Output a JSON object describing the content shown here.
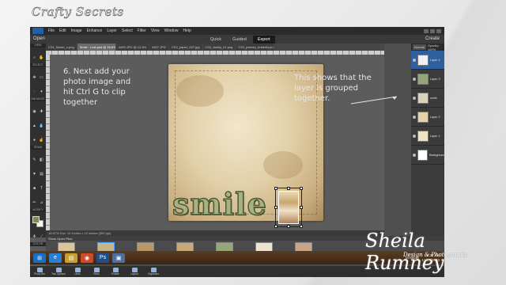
{
  "brand": {
    "logo_text": "Crafty Secrets",
    "watermark_name": "Sheila Rumney",
    "watermark_tagline": "Design & Photography"
  },
  "menubar": {
    "items": [
      "File",
      "Edit",
      "Image",
      "Enhance",
      "Layer",
      "Select",
      "Filter",
      "View",
      "Window",
      "Help"
    ]
  },
  "modebar": {
    "open_label": "Open",
    "tabs": [
      "Quick",
      "Guided",
      "Expert"
    ],
    "active_tab": "Expert",
    "create_label": "Create"
  },
  "doc_tabs": [
    "CS1_flower_c.png",
    "Smile : Lost.psd @ 16.6% (Layer 4, RGB/8)",
    "4405.JPG @ 12.4%",
    "4407.JPG",
    "CS2_paper_007.jpg",
    "CS2_family_01.png",
    "CS2_jewelry_butterfly.png"
  ],
  "toolbox": {
    "sections": [
      "VIEW",
      "SELECT",
      "ENHANCE",
      "DRAW",
      "MODIFY",
      "COLOR"
    ],
    "fg_color": "#7c8a55",
    "bg_color": "#f4f4f4"
  },
  "canvas": {
    "word": "smile"
  },
  "annotations": {
    "left": "6. Next add your photo image and hit Ctrl G to clip together",
    "right": "This shows that the layer is grouped together."
  },
  "status_bar": "16.67%   Doc: 12 inches x 12 inches (300 ppi)",
  "layers_panel": {
    "blend_mode": "Normal",
    "opacity_label": "Opacity: 100%",
    "layers": [
      {
        "name": "Layer 4",
        "selected": true,
        "thumb": "#f0f0f0"
      },
      {
        "name": "Layer 3",
        "selected": false,
        "thumb": "#95a679"
      },
      {
        "name": "smile",
        "selected": false,
        "thumb": "#d9d2bf"
      },
      {
        "name": "Layer 2",
        "selected": false,
        "thumb": "#e4d2aa"
      },
      {
        "name": "Layer 1",
        "selected": false,
        "thumb": "#efe3c4"
      },
      {
        "name": "Background",
        "selected": false,
        "thumb": "#ffffff"
      }
    ]
  },
  "photo_bin": {
    "header": "Show Open Files",
    "items": [
      {
        "label": "CS1_flower_c.png",
        "thumb": "#d9c79a"
      },
      {
        "label": "Smile - Lost.psd",
        "thumb": "#c9b48a",
        "active": true
      },
      {
        "label": "4405.JPG",
        "thumb": "#b8976a"
      },
      {
        "label": "4407.JPG",
        "thumb": "#c8a97c"
      },
      {
        "label": "CS2_paper_007.jpg",
        "thumb": "#95a679"
      },
      {
        "label": "CS2_family_01.png",
        "thumb": "#efe5cf"
      },
      {
        "label": "CS2_jewelry_butterfly.png",
        "thumb": "#c9a58a"
      }
    ]
  },
  "bottom_bar": [
    "Photo Bin",
    "Tool Options",
    "Undo",
    "Redo",
    "Rotate",
    "Layout",
    "Organizer"
  ],
  "taskbar": {
    "desktop_label": "Desktop",
    "time": "8:35 AM",
    "date": "12/17/2013"
  }
}
